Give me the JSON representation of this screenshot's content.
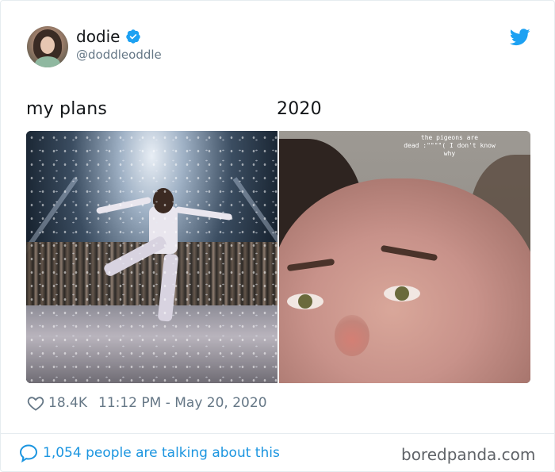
{
  "author": {
    "display_name": "dodie",
    "handle": "@doddleoddle",
    "verified": true,
    "avatar_icon": "profile-photo"
  },
  "tweet": {
    "caption_left": "my plans",
    "caption_right": "2020",
    "images": [
      {
        "name": "concert-stage-photo"
      },
      {
        "name": "crying-selfie-photo",
        "overlay_text": "the pigeons are\ndead :\"\"\"\"(  I don't know\nwhy"
      }
    ],
    "likes": "18.4K",
    "timestamp": "11:12 PM - May 20, 2020"
  },
  "footer": {
    "conversation_text": "1,054 people are talking about this",
    "watermark": "boredpanda.com"
  },
  "colors": {
    "twitter_blue": "#1da1f2",
    "link_blue": "#1b95e0",
    "muted_gray": "#657786"
  }
}
